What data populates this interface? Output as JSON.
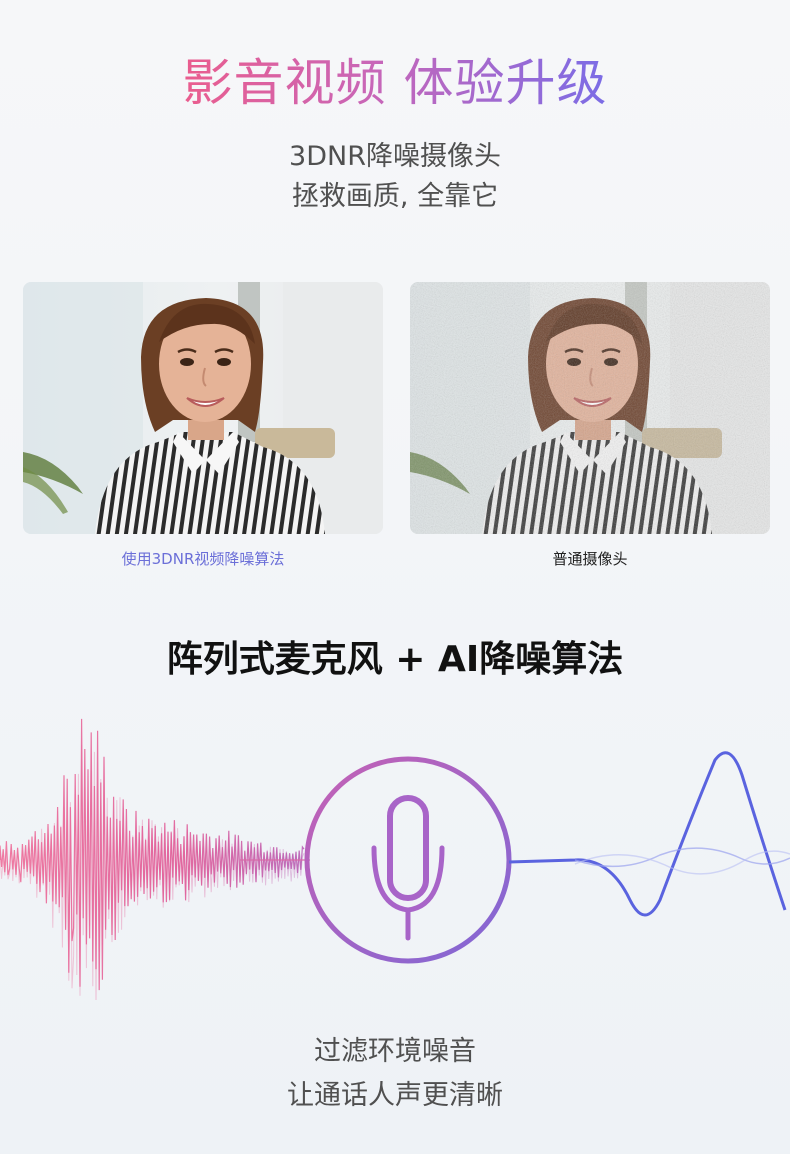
{
  "header": {
    "title": "影音视频 体验升级",
    "subtitle_line1": "3DNR降噪摄像头",
    "subtitle_line2": "拯救画质, 全靠它"
  },
  "comparison": {
    "left_caption": "使用3DNR视频降噪算法",
    "right_caption": "普通摄像头"
  },
  "mic_section": {
    "title": "阵列式麦克风 + AI降噪算法",
    "line1": "过滤环境噪音",
    "line2": "让通话人声更清晰",
    "mic_icon": "microphone-icon"
  },
  "colors": {
    "pink": "#e9578d",
    "purple": "#9a66d0",
    "blue": "#5a63df",
    "caption_left": "#6b6fd8",
    "caption_right": "#222222"
  }
}
